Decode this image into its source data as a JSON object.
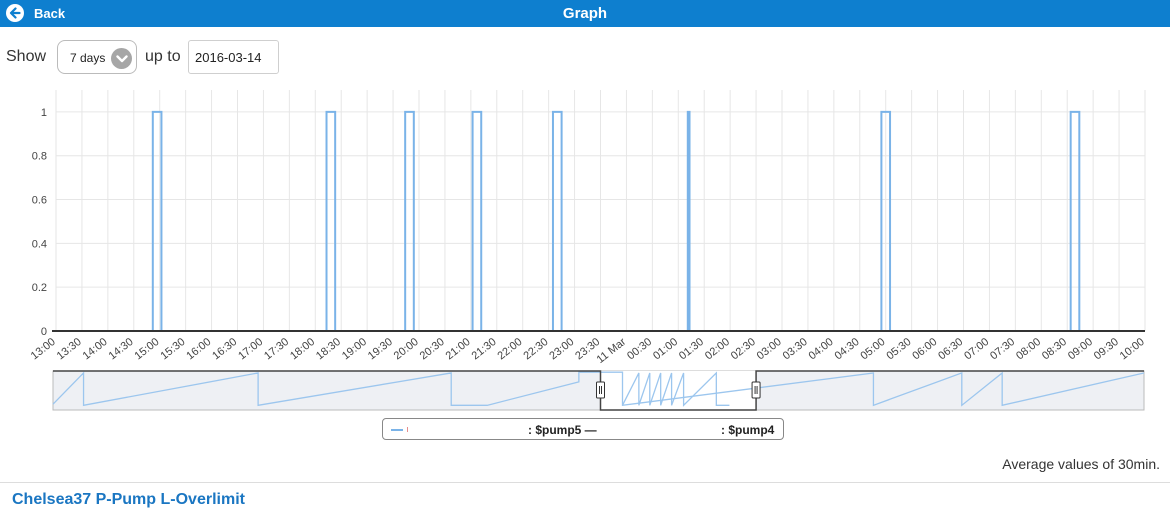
{
  "header": {
    "back_label": "Back",
    "title": "Graph"
  },
  "controls": {
    "show_label": "Show",
    "range_value": "7 days",
    "upto_label": "up to",
    "date_value": "2016-03-14"
  },
  "legend": {
    "series1": ": $pump5 —",
    "series2": ": $pump4"
  },
  "footer": {
    "average_note": "Average values of 30min.",
    "station_title": "Chelsea37 P-Pump L-Overlimit"
  },
  "colors": {
    "accent": "#0e7fcf",
    "series": "#7ab3e8",
    "footer_link": "#1a76c2"
  },
  "chart_data": {
    "type": "line",
    "step": true,
    "title": "",
    "xlabel": "",
    "ylabel": "",
    "ylim": [
      0,
      1.1
    ],
    "yticks": [
      0,
      0.2,
      0.4,
      0.6,
      0.8,
      1
    ],
    "ytick_labels": [
      "0",
      "0.2",
      "0.4",
      "0.6",
      "0.8",
      "1"
    ],
    "xticks": [
      "13:00",
      "13:30",
      "14:00",
      "14:30",
      "15:00",
      "15:30",
      "16:00",
      "16:30",
      "17:00",
      "17:30",
      "18:00",
      "18:30",
      "19:00",
      "19:30",
      "20:00",
      "20:30",
      "21:00",
      "21:30",
      "22:00",
      "22:30",
      "23:00",
      "23:30",
      "11 Mar",
      "00:30",
      "01:00",
      "01:30",
      "02:00",
      "02:30",
      "03:00",
      "03:30",
      "04:00",
      "04:30",
      "05:00",
      "05:30",
      "06:00",
      "06:30",
      "07:00",
      "07:30",
      "08:00",
      "08:30",
      "09:00",
      "09:30",
      "10:00"
    ],
    "grid": true,
    "series": [
      {
        "name": "$pump4",
        "pulses": [
          {
            "start": "14:52",
            "end": "15:02"
          },
          {
            "start": "18:13",
            "end": "18:23"
          },
          {
            "start": "19:44",
            "end": "19:54"
          },
          {
            "start": "21:02",
            "end": "21:12"
          },
          {
            "start": "22:35",
            "end": "22:45"
          },
          {
            "start": "01:11",
            "end": "01:13"
          },
          {
            "start": "04:55",
            "end": "05:05"
          },
          {
            "start": "08:34",
            "end": "08:44"
          }
        ]
      }
    ],
    "navigator": {
      "selected_window": [
        "23:30",
        "02:30"
      ],
      "sawtooth_main": [
        [
          0,
          0.15
        ],
        [
          0.028,
          0.95
        ],
        [
          0.028,
          0.12
        ],
        [
          0.188,
          0.95
        ],
        [
          0.188,
          0.12
        ],
        [
          0.365,
          0.95
        ],
        [
          0.365,
          0.12
        ],
        [
          0.398,
          0.12
        ],
        [
          0.482,
          0.72
        ],
        [
          0.482,
          0.97
        ],
        [
          0.522,
          0.97
        ],
        [
          0.522,
          0.12
        ],
        [
          0.752,
          0.95
        ],
        [
          0.752,
          0.12
        ],
        [
          0.833,
          0.95
        ],
        [
          0.833,
          0.12
        ],
        [
          0.87,
          0.95
        ],
        [
          0.87,
          0.12
        ],
        [
          1.0,
          0.95
        ]
      ],
      "sawtooth_detail": [
        [
          0.522,
          0.12
        ],
        [
          0.537,
          0.95
        ],
        [
          0.537,
          0.12
        ],
        [
          0.547,
          0.95
        ],
        [
          0.547,
          0.12
        ],
        [
          0.557,
          0.95
        ],
        [
          0.557,
          0.12
        ],
        [
          0.567,
          0.95
        ],
        [
          0.567,
          0.12
        ],
        [
          0.578,
          0.95
        ],
        [
          0.578,
          0.12
        ],
        [
          0.608,
          0.95
        ],
        [
          0.608,
          0.12
        ],
        [
          0.62,
          0.12
        ]
      ]
    }
  }
}
